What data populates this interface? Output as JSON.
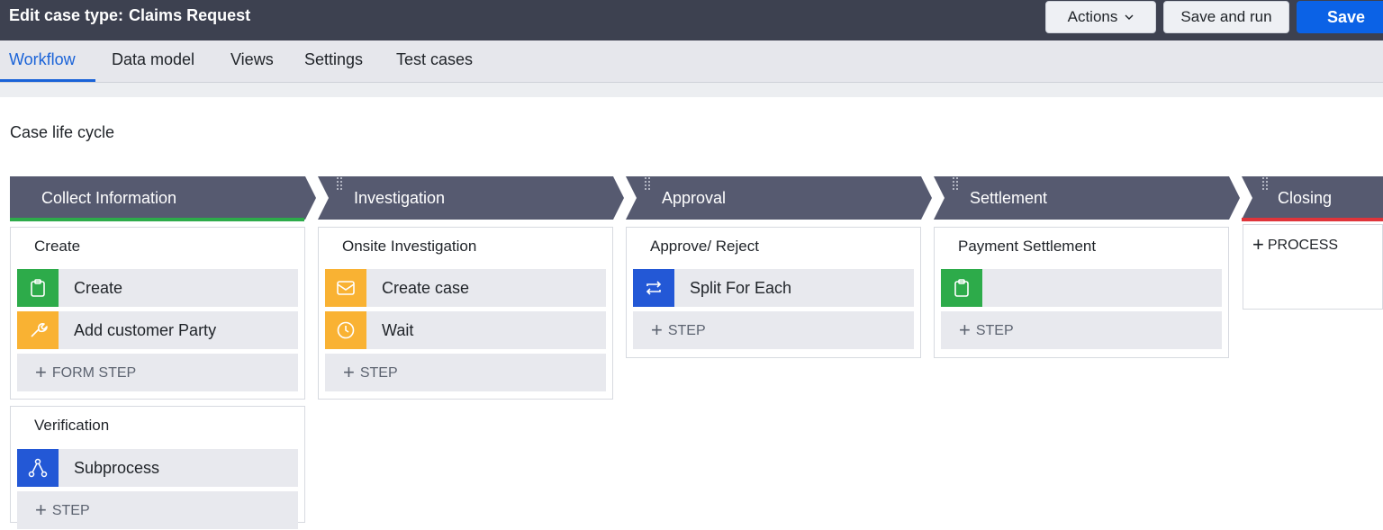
{
  "header": {
    "title_prefix": "Edit case type:",
    "case_type_name": "Claims Request",
    "actions_label": "Actions",
    "save_and_run_label": "Save and run",
    "save_label": "Save"
  },
  "tabs": [
    {
      "label": "Workflow",
      "active": true
    },
    {
      "label": "Data model",
      "active": false
    },
    {
      "label": "Views",
      "active": false
    },
    {
      "label": "Settings",
      "active": false
    },
    {
      "label": "Test cases",
      "active": false
    }
  ],
  "section_title": "Case life cycle",
  "colors": {
    "topbar": "#3d4150",
    "stage": "#565a70",
    "accent_blue": "#0b62e6",
    "stage_complete": "#2dab4a",
    "stage_closing": "#e0343a",
    "icon_green": "#2dab4a",
    "icon_orange": "#f9b233",
    "icon_blue": "#2358d6"
  },
  "stages": [
    {
      "name": "Collect Information",
      "processes": [
        {
          "title": "Create",
          "steps": [
            {
              "label": "Create",
              "icon": "clipboard-icon",
              "color": "#2dab4a"
            },
            {
              "label": "Add customer Party",
              "icon": "wrench-icon",
              "color": "#f9b233"
            }
          ],
          "add_label": "FORM STEP"
        },
        {
          "title": "Verification",
          "steps": [
            {
              "label": "Subprocess",
              "icon": "subprocess-icon",
              "color": "#2358d6"
            }
          ],
          "add_label": "STEP"
        }
      ]
    },
    {
      "name": "Investigation",
      "processes": [
        {
          "title": "Onsite Investigation",
          "steps": [
            {
              "label": "Create case",
              "icon": "envelope-icon",
              "color": "#f9b233"
            },
            {
              "label": "Wait",
              "icon": "clock-icon",
              "color": "#f9b233"
            }
          ],
          "add_label": "STEP"
        }
      ]
    },
    {
      "name": "Approval",
      "processes": [
        {
          "title": "Approve/ Reject",
          "steps": [
            {
              "label": "Split For Each",
              "icon": "loop-icon",
              "color": "#2358d6"
            }
          ],
          "add_label": "STEP"
        }
      ]
    },
    {
      "name": "Settlement",
      "processes": [
        {
          "title": "Payment Settlement",
          "steps": [
            {
              "label": "",
              "icon": "clipboard-icon",
              "color": "#2dab4a"
            }
          ],
          "add_label": "STEP"
        }
      ]
    },
    {
      "name": "Closing",
      "processes": [],
      "add_process_label": "PROCESS"
    }
  ]
}
